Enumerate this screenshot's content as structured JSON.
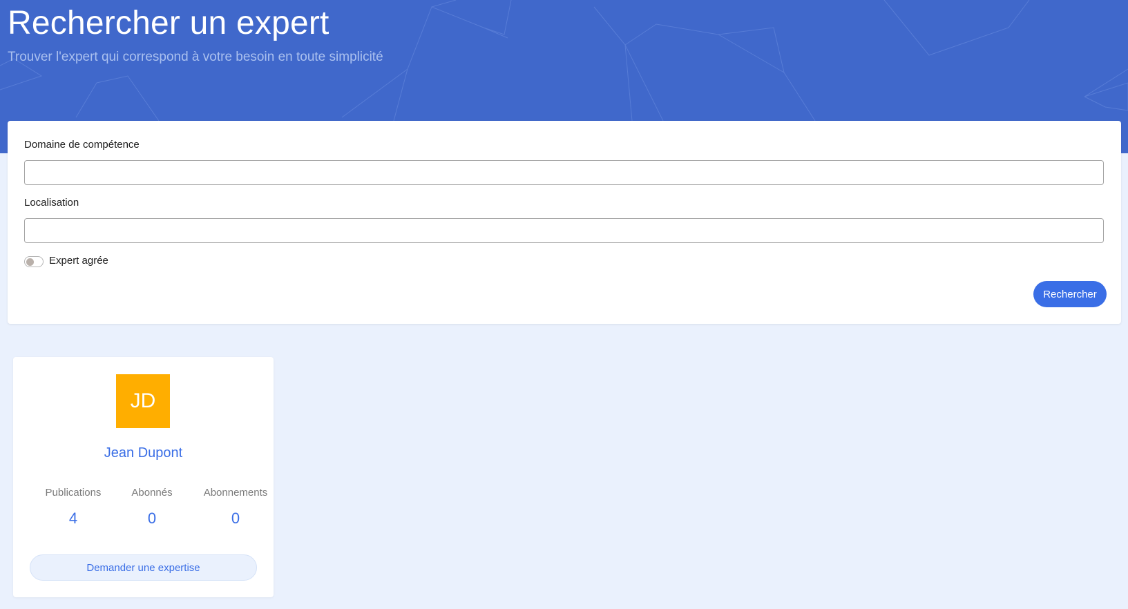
{
  "header": {
    "title": "Rechercher un expert",
    "subtitle": "Trouver l'expert qui correspond à votre besoin en toute simplicité"
  },
  "search_form": {
    "domain_label": "Domaine de compétence",
    "domain_value": "",
    "location_label": "Localisation",
    "location_value": "",
    "approved_toggle_label": "Expert agrée",
    "approved_toggle_on": false,
    "submit_label": "Rechercher"
  },
  "experts": [
    {
      "initials": "JD",
      "name": "Jean Dupont",
      "avatar_color": "#ffae00",
      "stats": [
        {
          "label": "Publications",
          "value": "4"
        },
        {
          "label": "Abonnés",
          "value": "0"
        },
        {
          "label": "Abonnements",
          "value": "0"
        }
      ],
      "action_label": "Demander une expertise"
    }
  ],
  "colors": {
    "header_bg": "#4068cb",
    "accent": "#3a6ee6",
    "page_bg": "#eaf1fd"
  }
}
